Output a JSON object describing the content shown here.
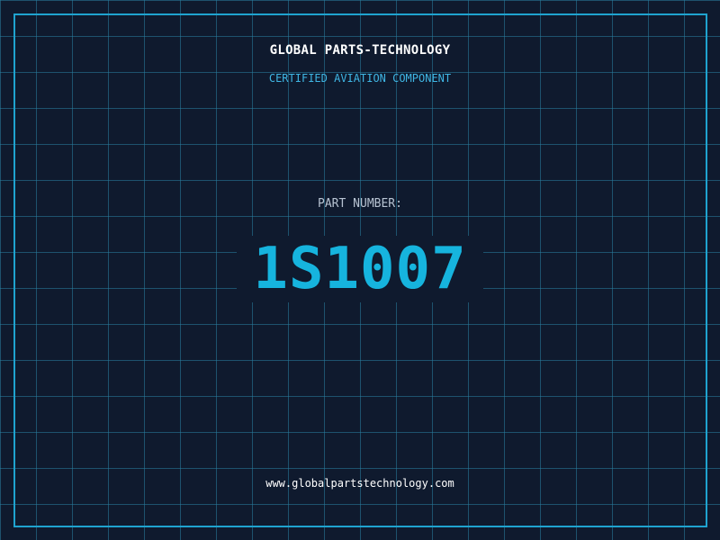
{
  "header": {
    "company": "GLOBAL PARTS-TECHNOLOGY",
    "tagline": "CERTIFIED AVIATION COMPONENT"
  },
  "part": {
    "label": "PART NUMBER:",
    "number": "1S1007"
  },
  "footer": {
    "url": "www.globalpartstechnology.com"
  },
  "colors": {
    "background": "#0f1a2e",
    "grid": "#2980a0",
    "frame": "#1fa3cf",
    "accent": "#16b4de",
    "subtitle": "#3fb6e4",
    "label": "#b7c3d2",
    "text": "#ffffff"
  }
}
